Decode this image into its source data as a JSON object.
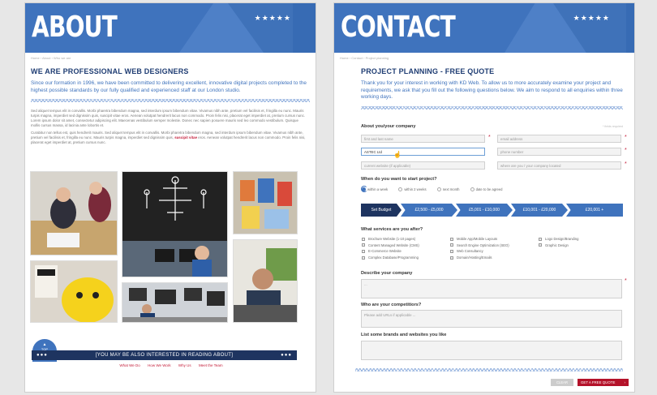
{
  "about": {
    "title": "ABOUT",
    "stars": "★★★★★",
    "breadcrumb": "Home › About › Who we are",
    "heading": "WE ARE PROFESSIONAL WEB DESIGNERS",
    "lead": "Since our formation in 1996, we have been committed to delivering excellent, innovative digital projects completed to the highest possible standards by our fully qualified and experienced staff at our London studio.",
    "para1": "Sed aliquet tempus elit in convallis. Morbi pharetra bibendum magna, sed interdum ipsum bibendum vitae. Vivamus nibh ante, pretium vel facilisis et, fringilla eu nunc. Mauris turpis magna, imperdiet sed dignissim quis, suscipit vitae eros. Aenean volutpat hendrerit lacus non commodo. Proin felis nisi, placerat eget imperdiet at, pretium cursus nunc. Lorem ipsum dolor sit amet, consectetur adipiscing elit. Maecenas vestibulum semper molestie. Donec nec sapien posuere mauris sed leo commodo vestibulum. Quisque mollis cursus massa, id lacinia ante lobortis et.",
    "para2_a": "Curabitur non tellus est, quis hendrerit mauris. Sed aliquet tempus elit in convallis. Morbi pharetra bibendum magna, sed interdum ipsum bibendum vitae. Vivamus nibh ante, pretium vel facilisis et, fringilla eu nunc. Mauris turpis magna, imperdiet sed dignissim quis,",
    "para2_b": "suscipit vitae",
    "para2_c": "eros. Aenean volutpat hendrerit lacus non commodo. Proin felis nisi, placerat eget imperdiet at, pretium cursus nunc.",
    "top_label": "TOP",
    "banner": "[YOU MAY BE ALSO INTERESTED IN READING ABOUT]",
    "dots": "●●●",
    "links": [
      "What We Do",
      "How We Work",
      "Why Us",
      "Meet the Team"
    ]
  },
  "contact": {
    "title": "CONTACT",
    "stars": "★★★★★",
    "breadcrumb": "Home › Contact › Project planning",
    "heading": "PROJECT PLANNING - FREE QUOTE",
    "lead": "Thank you for your interest in working with KD Web. To allow us to more accurately examine your project and requirements, we ask that you fill out the following questions below. We aim to respond to all enquiries within three working days.",
    "about_label": "About you/your company",
    "required_note": "* fields required",
    "fields": {
      "name": "first and last name",
      "email": "email address",
      "company": "ASTEC Ltd",
      "phone": "phone number",
      "website": "current website (if applicable)",
      "location": "where are you / your company located"
    },
    "start_label": "When do you want to start project?",
    "start_options": [
      "within a week",
      "within 2 weeks",
      "next month",
      "date to be agreed"
    ],
    "budget_label": "Set Budget",
    "budget_options": [
      "£2,500 - £5,000",
      "£5,001 - £10,000",
      "£10,001 - £20,000",
      "£20,001 +"
    ],
    "services_label": "What services are you after?",
    "services_col1": [
      "Brochure Website (1-10 pages)",
      "Content Managed Website (CMS)",
      "E-Commerce Website",
      "Complex Database/Programming"
    ],
    "services_col2": [
      "Mobile App/Mobile Layouts",
      "Search Engine Optimization (SEO)",
      "Web Consultancy",
      "Domain/Hosting/Emails"
    ],
    "services_col3": [
      "Logo Design/Branding",
      "Graphic Design"
    ],
    "describe_label": "Describe your company",
    "describe_value": "...",
    "competitors_label": "Who are your competitiors?",
    "competitors_placeholder": "Please add URLs if applicable ...",
    "brands_label": "List some brands and websites you like",
    "clear_label": "CLEAR",
    "quote_label": "GET A FREE QUOTE"
  }
}
